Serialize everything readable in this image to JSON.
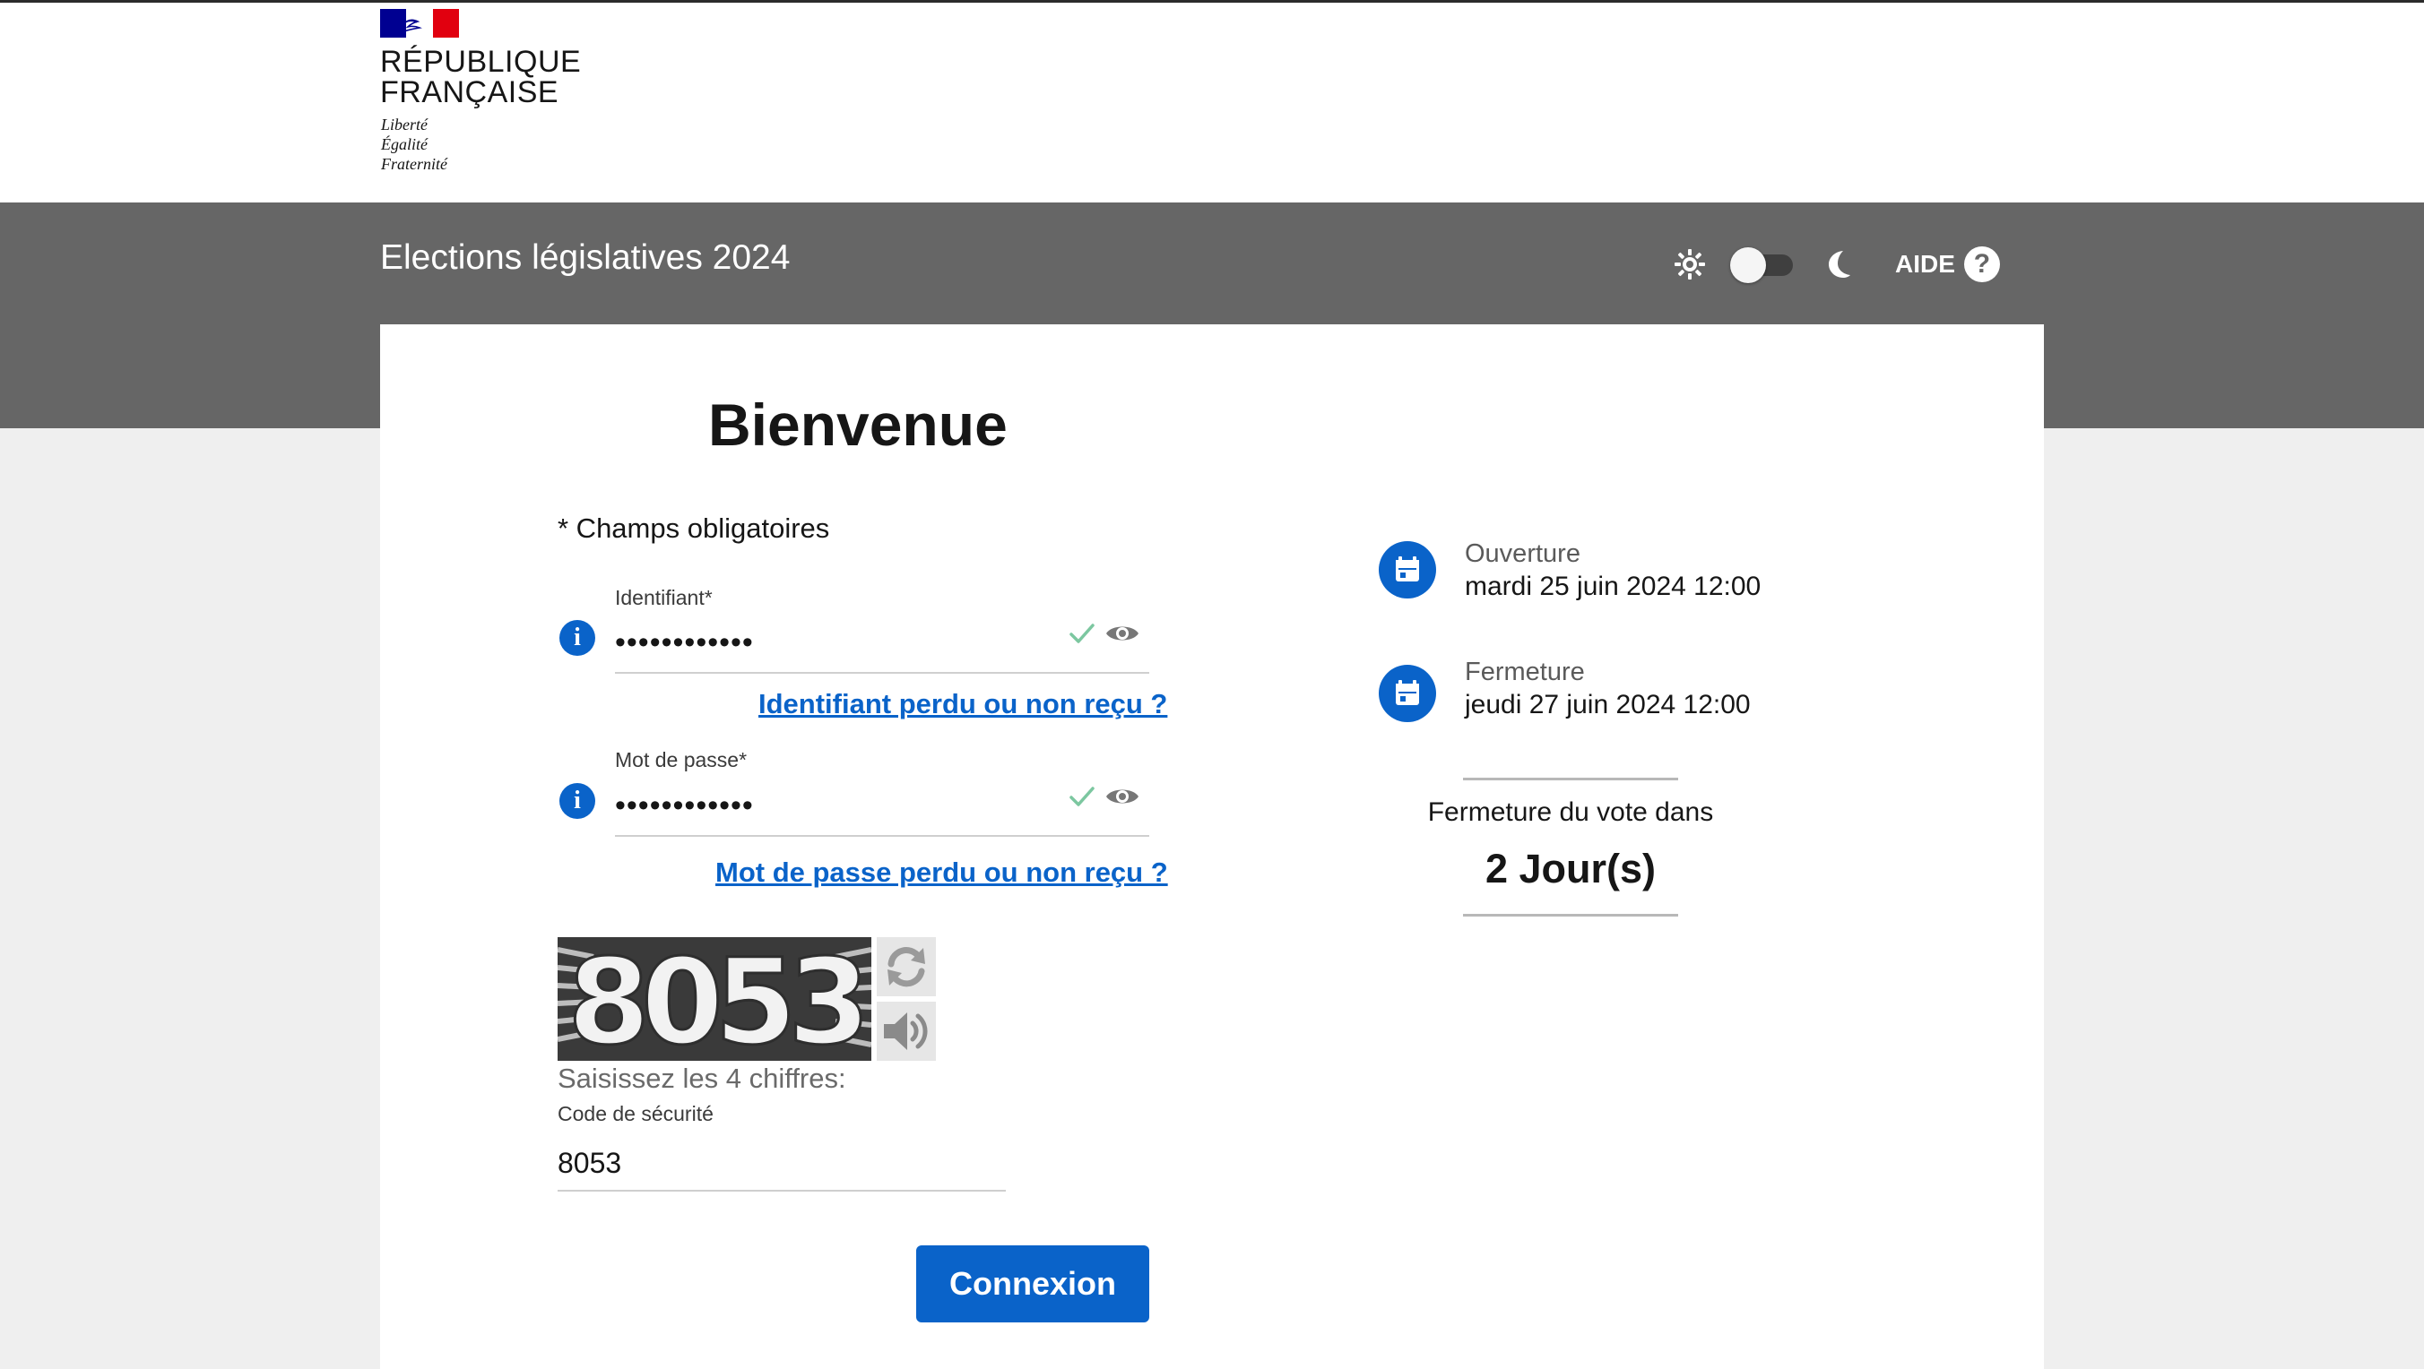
{
  "logo": {
    "name_line1": "RÉPUBLIQUE",
    "name_line2": "FRANÇAISE",
    "motto": [
      "Liberté",
      "Égalité",
      "Fraternité"
    ],
    "colors": {
      "blue": "#000091",
      "white": "#ffffff",
      "red": "#e1000f"
    }
  },
  "header": {
    "title": "Elections législatives 2024",
    "theme_toggle": {
      "light_icon": "sun-icon",
      "dark_icon": "moon-icon",
      "dark_mode": false
    },
    "help_label": "AIDE",
    "help_icon": "question-icon"
  },
  "form": {
    "welcome": "Bienvenue",
    "required_note": "* Champs obligatoires",
    "identifier": {
      "label": "Identifiant*",
      "value": "••••••••••••",
      "valid": true,
      "lost_link": "Identifiant perdu ou non reçu ?"
    },
    "password": {
      "label": "Mot de passe*",
      "value": "••••••••••••",
      "valid": true,
      "lost_link": "Mot de passe perdu ou non reçu ?"
    },
    "captcha": {
      "image_text": "8053",
      "hint": "Saisissez les 4 chiffres:",
      "code_label": "Code de sécurité",
      "code_value": "8053"
    },
    "submit_label": "Connexion"
  },
  "schedule": {
    "opening": {
      "label": "Ouverture",
      "value": "mardi 25 juin 2024 12:00"
    },
    "closing": {
      "label": "Fermeture",
      "value": "jeudi 27 juin 2024 12:00"
    },
    "countdown_label": "Fermeture du vote dans",
    "countdown_value": "2 Jour(s)"
  },
  "colors": {
    "accent": "#0a63c9",
    "header_band": "#666666",
    "valid_check": "#7cc7a0"
  }
}
